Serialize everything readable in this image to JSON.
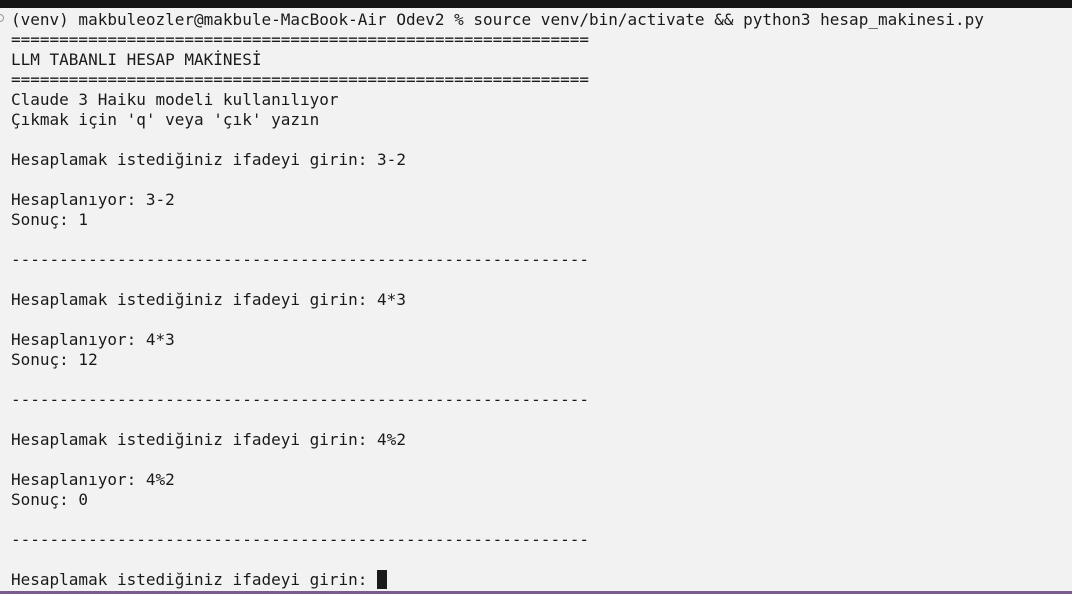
{
  "terminal": {
    "command_line": "(venv) makbuleozler@makbule-MacBook-Air Odev2 % source venv/bin/activate && python3 hesap_makinesi.py",
    "separator_double": "============================================================",
    "title": "LLM TABANLI HESAP MAKİNESİ",
    "model_info": "Claude 3 Haiku modeli kullanılıyor",
    "exit_hint": "Çıkmak için 'q' veya 'çık' yazın",
    "separator_dash": "------------------------------------------------------------",
    "interactions": [
      {
        "prompt": "Hesaplamak istediğiniz ifadeyi girin: 3-2",
        "computing": "Hesaplanıyor: 3-2",
        "result": "Sonuç: 1"
      },
      {
        "prompt": "Hesaplamak istediğiniz ifadeyi girin: 4*3",
        "computing": "Hesaplanıyor: 4*3",
        "result": "Sonuç: 12"
      },
      {
        "prompt": "Hesaplamak istediğiniz ifadeyi girin: 4%2",
        "computing": "Hesaplanıyor: 4%2",
        "result": "Sonuç: 0"
      }
    ],
    "current_prompt": "Hesaplamak istediğiniz ifadeyi girin: "
  }
}
